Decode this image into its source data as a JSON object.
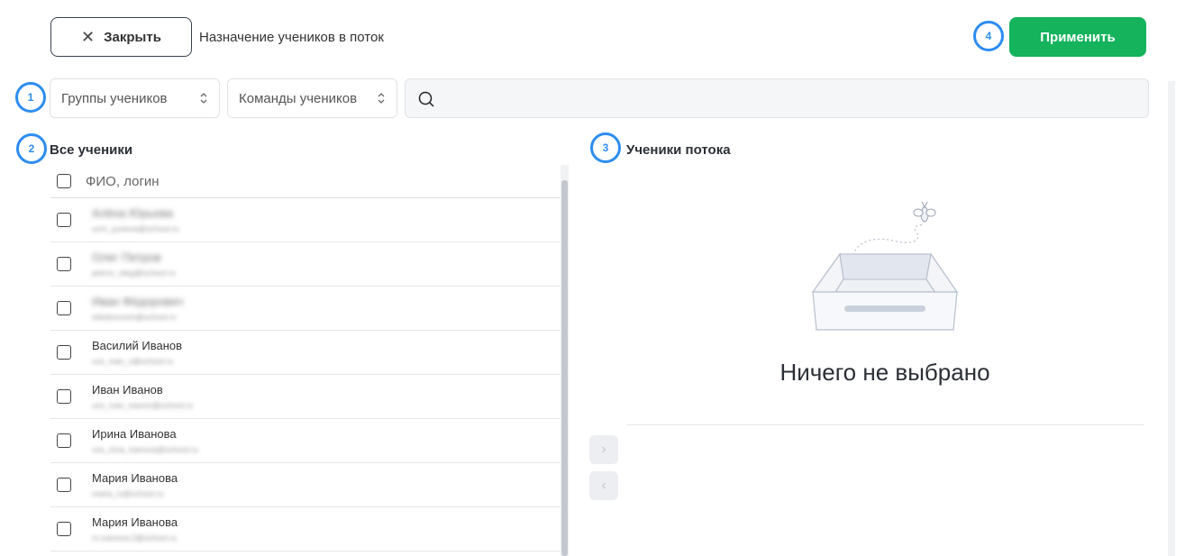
{
  "header": {
    "close_label": "Закрыть",
    "close_icon": "close-icon",
    "title": "Назначение учеников в поток",
    "apply_label": "Применить"
  },
  "markers": [
    "1",
    "2",
    "3",
    "4"
  ],
  "filters": {
    "groups_label": "Группы учеников",
    "teams_label": "Команды учеников",
    "search_value": ""
  },
  "all_students": {
    "title": "Все ученики",
    "header_label": "ФИО, логин",
    "rows": [
      {
        "name": "Алёна Юрьева",
        "login": "ucm_yurieva@school.ru"
      },
      {
        "name": "Олег Петров",
        "login": "petrov_oleg@school.ru"
      },
      {
        "name": "Иван Фёдорович",
        "login": "ivfedorovich@school.ru"
      },
      {
        "name": "Василий Иванов",
        "login": "uvs_ivan_v@school.ru"
      },
      {
        "name": "Иван Иванов",
        "login": "uvs_ivan_ivanov@school.ru"
      },
      {
        "name": "Ирина Иванова",
        "login": "uvs_irina_ivanova@school.ru"
      },
      {
        "name": "Мария Иванова",
        "login": "maria_iv@school.ru"
      },
      {
        "name": "Мария Иванова",
        "login": "m.ivanova.2@school.ru"
      }
    ]
  },
  "stream_students": {
    "title": "Ученики потока",
    "empty_text": "Ничего не выбрано"
  },
  "transfer": {
    "to_right": "›",
    "to_left": "‹"
  },
  "colors": {
    "accent": "#14b35c",
    "marker": "#2d8cf0"
  }
}
